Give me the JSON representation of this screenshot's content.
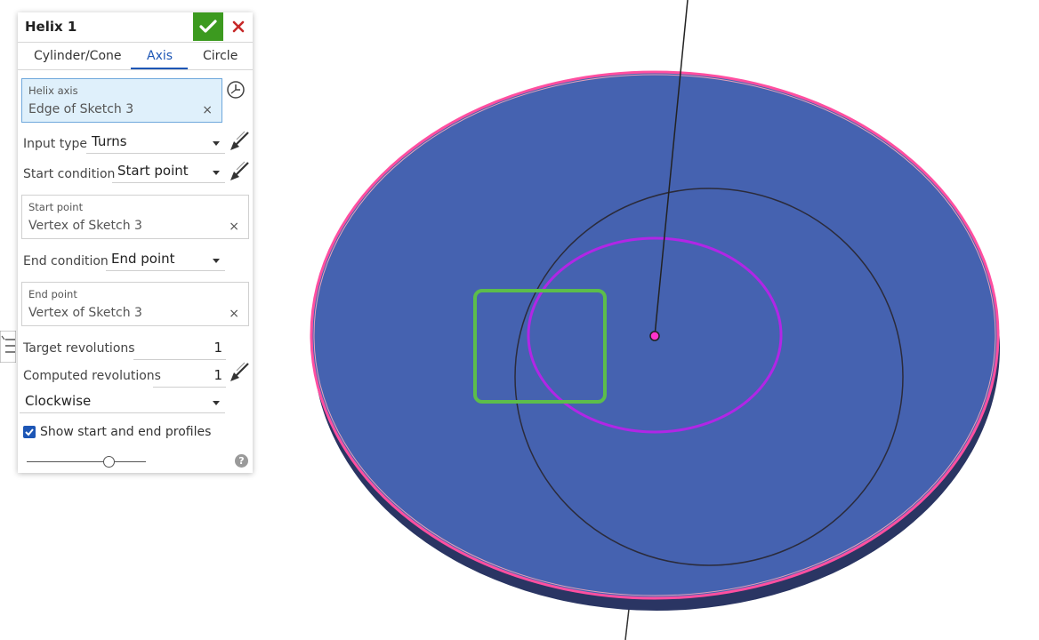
{
  "panel": {
    "title": "Helix 1",
    "tabs": [
      "Cylinder/Cone",
      "Axis",
      "Circle"
    ],
    "active_tab": "Axis",
    "helix_axis": {
      "caption": "Helix axis",
      "value": "Edge of Sketch 3",
      "clear": "×"
    },
    "input_type": {
      "label": "Input type",
      "value": "Turns"
    },
    "start_condition": {
      "label": "Start condition",
      "value": "Start point"
    },
    "start_point": {
      "caption": "Start point",
      "value": "Vertex of Sketch 3",
      "clear": "×"
    },
    "end_condition": {
      "label": "End condition",
      "value": "End point"
    },
    "end_point": {
      "caption": "End point",
      "value": "Vertex of Sketch 3",
      "clear": "×"
    },
    "target_revolutions": {
      "label": "Target revolutions",
      "value": "1"
    },
    "computed_revolutions": {
      "label": "Computed revolutions",
      "value": "1"
    },
    "direction": {
      "value": "Clockwise"
    },
    "show_profiles": {
      "label": "Show start and end profiles",
      "checked": true
    },
    "help": "?"
  },
  "colors": {
    "accept": "#3c9a1f",
    "cancel": "#c62828",
    "accent": "#1d56b5",
    "disk_face": "#4562b0",
    "disk_edge": "#2a3563",
    "highlight_pink": "#ff4fa0",
    "profile_purple": "#b126e6",
    "preview_green": "#5cbd4b"
  },
  "icons": [
    "check-icon",
    "close-icon",
    "history-icon",
    "flip-direction-icon",
    "help-icon",
    "list-icon"
  ]
}
